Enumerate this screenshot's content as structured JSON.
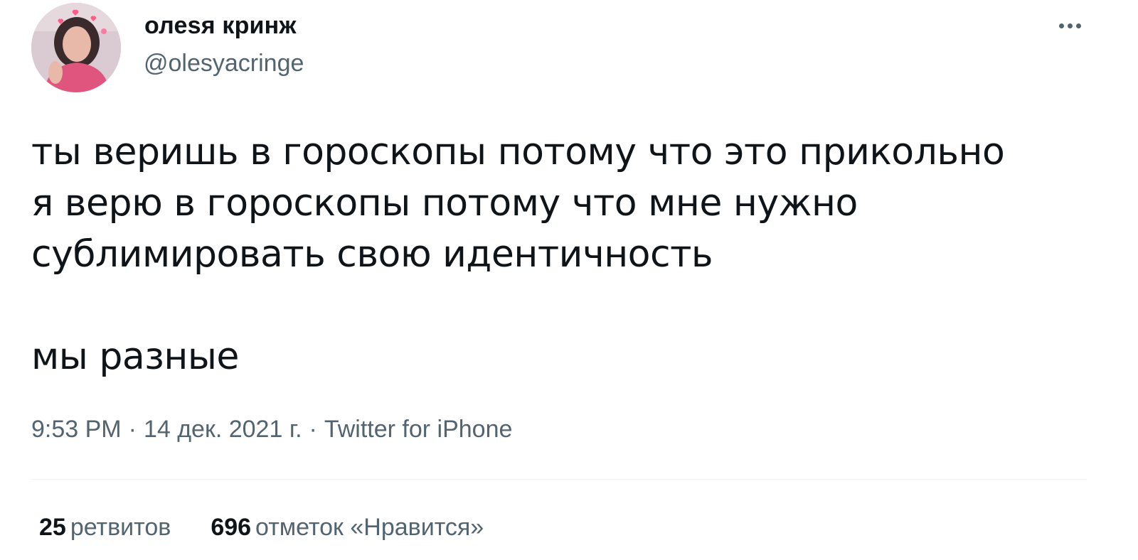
{
  "author": {
    "display_name": "олеsя кринж",
    "handle": "@olesyacringe",
    "avatar_icon": "user-avatar-photo"
  },
  "menu_icon": "more-options-icon",
  "tweet": {
    "lines": [
      "ты веришь в гороскопы потому что это прикольно",
      "я верю в гороскопы потому что мне нужно",
      "сублимировать свою идентичность",
      "мы разные"
    ]
  },
  "meta": {
    "time": "9:53 PM",
    "separator": "·",
    "date": "14 дек. 2021 г.",
    "source": "Twitter for iPhone"
  },
  "stats": {
    "retweets_count": "25",
    "retweets_label": "ретвитов",
    "likes_count": "696",
    "likes_label": "отметок «Нравится»"
  },
  "colors": {
    "text_primary": "#0f1419",
    "text_secondary": "#536471",
    "divider": "#eff3f4"
  }
}
